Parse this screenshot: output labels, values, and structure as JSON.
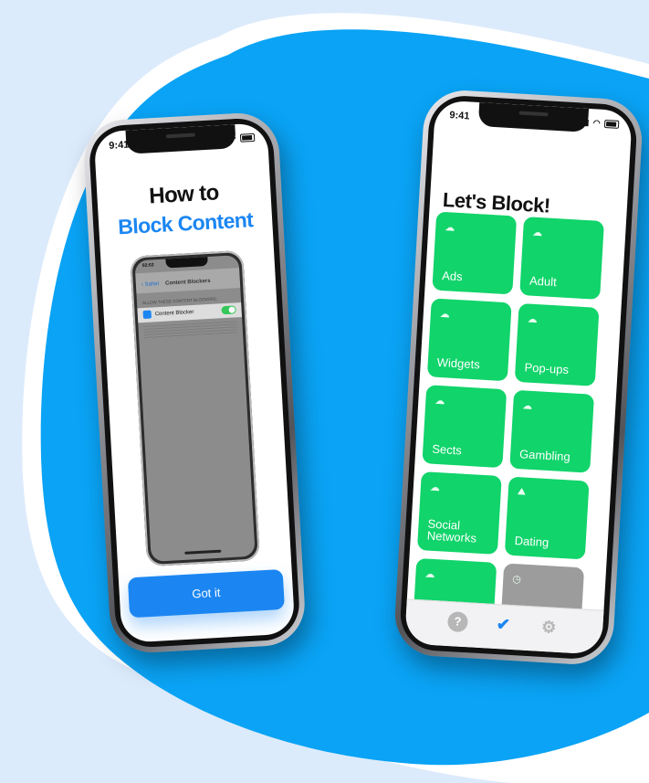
{
  "left_phone": {
    "status_time": "9:41",
    "title": "How to",
    "subtitle": "Block Content",
    "mini_screen": {
      "time": "02:02",
      "nav_back": "Safari",
      "nav_title": "Content Blockers",
      "section_label": "ALLOW THESE CONTENT BLOCKERS:",
      "row_label": "Content Blocker"
    },
    "button_label": "Got it"
  },
  "right_phone": {
    "status_time": "9:41",
    "title": "Let's Block!",
    "tiles": [
      {
        "label": "Ads"
      },
      {
        "label": "Adult"
      },
      {
        "label": "Widgets"
      },
      {
        "label": "Pop-ups"
      },
      {
        "label": "Sects"
      },
      {
        "label": "Gambling"
      },
      {
        "label": "Social Networks"
      },
      {
        "label": "Dating"
      },
      {
        "label": ""
      },
      {
        "label": ""
      }
    ],
    "tabs": {
      "help": "?",
      "shield": "✔",
      "settings": "⚙"
    }
  },
  "colors": {
    "blob": "#0aa3f5",
    "accent_blue": "#1b86f2",
    "tile_green": "#11d46a",
    "tile_gray": "#9c9c9c"
  }
}
